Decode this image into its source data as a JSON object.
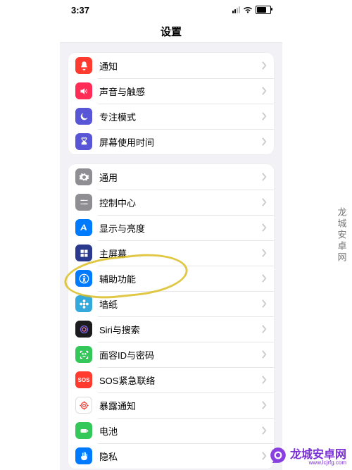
{
  "status": {
    "time": "3:37"
  },
  "nav": {
    "title": "设置"
  },
  "groups": [
    {
      "items": [
        {
          "key": "notifications",
          "label": "通知"
        },
        {
          "key": "sounds",
          "label": "声音与触感"
        },
        {
          "key": "focus",
          "label": "专注模式"
        },
        {
          "key": "screentime",
          "label": "屏幕使用时间"
        }
      ]
    },
    {
      "items": [
        {
          "key": "general",
          "label": "通用"
        },
        {
          "key": "controlcenter",
          "label": "控制中心"
        },
        {
          "key": "display",
          "label": "显示与亮度"
        },
        {
          "key": "homescreen",
          "label": "主屏幕"
        },
        {
          "key": "accessibility",
          "label": "辅助功能",
          "highlighted": true
        },
        {
          "key": "wallpaper",
          "label": "墙纸"
        },
        {
          "key": "siri",
          "label": "Siri与搜索"
        },
        {
          "key": "faceid",
          "label": "面容ID与密码"
        },
        {
          "key": "sos",
          "label": "SOS紧急联络"
        },
        {
          "key": "exposure",
          "label": "暴露通知"
        },
        {
          "key": "battery",
          "label": "电池"
        },
        {
          "key": "privacy",
          "label": "隐私"
        }
      ]
    }
  ],
  "watermark": {
    "side_text": "龙城安卓网",
    "logo_text": "龙城安卓网",
    "logo_sub": "www.lcjrfg.com"
  }
}
